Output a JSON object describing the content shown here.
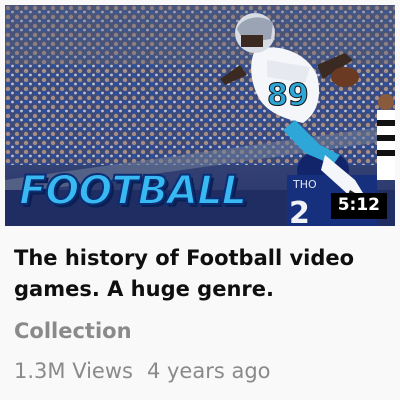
{
  "video": {
    "thumbnail_label": "FOOTBALL",
    "duration": "5:12",
    "title": "The history of Football video games. A huge genre.",
    "channel": "Collection",
    "views": "1.3M Views",
    "age": "4 years ago"
  }
}
